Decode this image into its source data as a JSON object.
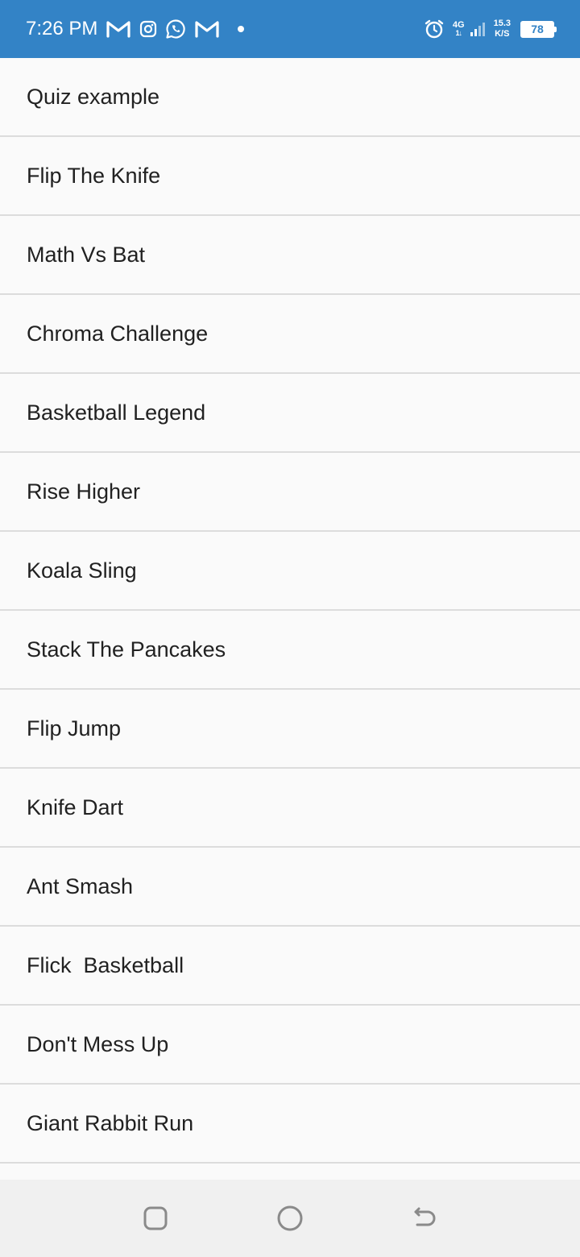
{
  "status_bar": {
    "time": "7:26 PM",
    "network_type": "4G",
    "net_arrows": "1↓",
    "speed_value": "15.3",
    "speed_unit": "K/S",
    "battery": "78",
    "icons": [
      "gmail-icon",
      "instagram-icon",
      "whatsapp-icon",
      "gmail-icon",
      "notification-dot",
      "alarm-icon",
      "signal-icon",
      "battery-icon"
    ]
  },
  "games": [
    "Quiz example",
    "Flip The Knife",
    "Math Vs Bat",
    "Chroma Challenge",
    "Basketball Legend",
    "Rise Higher",
    "Koala Sling",
    "Stack The Pancakes",
    "Flip Jump",
    "Knife Dart",
    "Ant Smash",
    "Flick  Basketball",
    "Don't Mess Up",
    "Giant Rabbit Run"
  ],
  "nav_bar": {
    "icons": [
      "recent-apps-icon",
      "home-icon",
      "back-icon"
    ]
  },
  "colors": {
    "status_bar": "#3383c6",
    "list_background": "#fafafa",
    "divider": "#dcdcdc",
    "text": "#212121",
    "nav_bar": "#f0f0f0"
  }
}
